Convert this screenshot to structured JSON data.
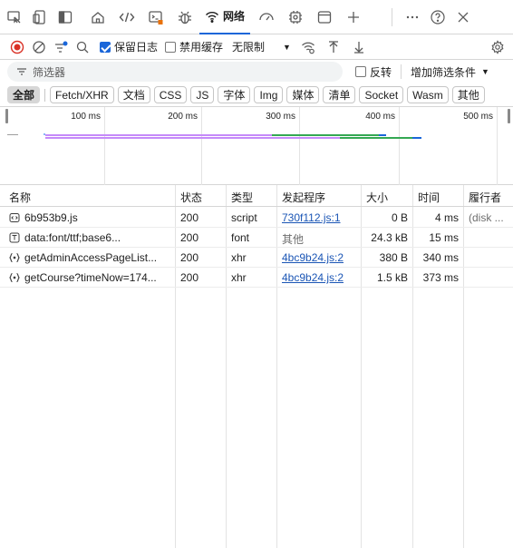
{
  "toolbar": {
    "network_tab_label": "网络"
  },
  "recording": {
    "preserve_log_label": "保留日志",
    "preserve_log_checked": true,
    "disable_cache_label": "禁用缓存",
    "disable_cache_checked": false,
    "throttle_value": "无限制"
  },
  "filter": {
    "placeholder": "筛选器",
    "invert_label": "反转",
    "more_filters_label": "增加筛选条件"
  },
  "type_filters": [
    "全部",
    "Fetch/XHR",
    "文档",
    "CSS",
    "JS",
    "字体",
    "Img",
    "媒体",
    "清单",
    "Socket",
    "Wasm",
    "其他"
  ],
  "overview": {
    "ticks": [
      "100 ms",
      "200 ms",
      "300 ms",
      "400 ms",
      "500 ms"
    ]
  },
  "table": {
    "columns": [
      "名称",
      "状态",
      "类型",
      "发起程序",
      "大小",
      "时间",
      "履行者"
    ],
    "rows": [
      {
        "icon": "script-icon",
        "name": "6b953b9.js",
        "status": "200",
        "type": "script",
        "initiator": "730f112.js:1",
        "initiator_link": true,
        "size": "0 B",
        "time": "4 ms",
        "fulfilled_by": "(disk ..."
      },
      {
        "icon": "font-icon",
        "name": "data:font/ttf;base6...",
        "status": "200",
        "type": "font",
        "initiator": "其他",
        "initiator_link": false,
        "size": "24.3 kB",
        "time": "15 ms",
        "fulfilled_by": ""
      },
      {
        "icon": "xhr-icon",
        "name": "getAdminAccessPageList...",
        "status": "200",
        "type": "xhr",
        "initiator": "4bc9b24.js:2",
        "initiator_link": true,
        "size": "380 B",
        "time": "340 ms",
        "fulfilled_by": ""
      },
      {
        "icon": "xhr-icon",
        "name": "getCourse?timeNow=174...",
        "status": "200",
        "type": "xhr",
        "initiator": "4bc9b24.js:2",
        "initiator_link": true,
        "size": "1.5 kB",
        "time": "373 ms",
        "fulfilled_by": ""
      }
    ]
  },
  "colors": {
    "accent": "#1a66d9",
    "record": "#d93025",
    "link": "#1a55b5"
  }
}
